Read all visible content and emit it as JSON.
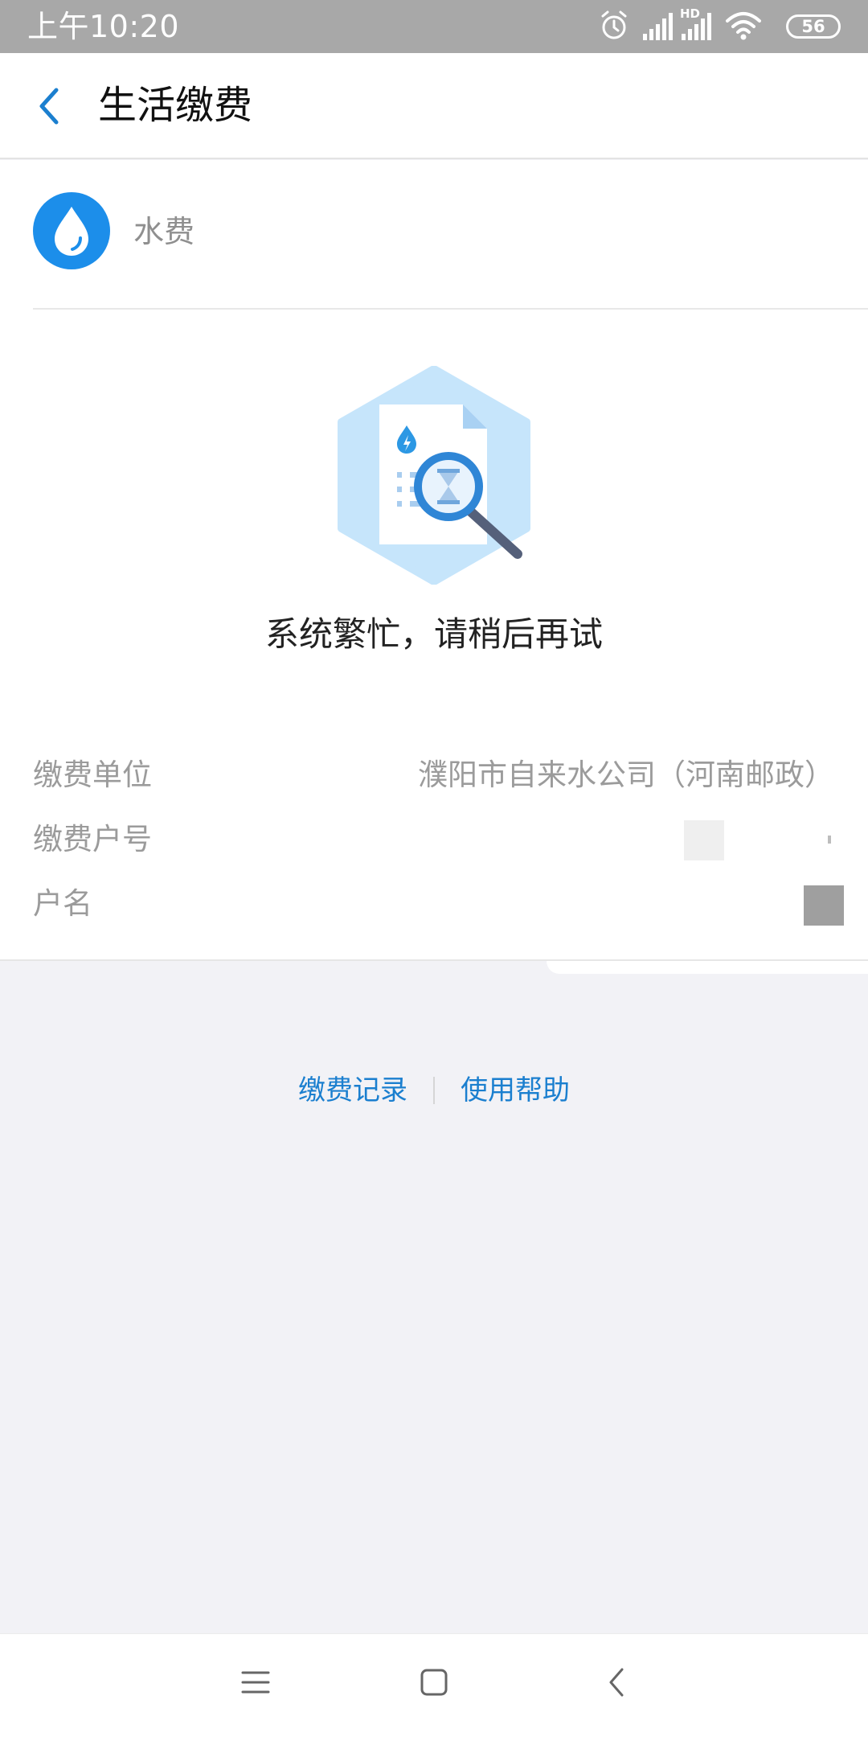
{
  "status_bar": {
    "time": "上午10:20",
    "network_badge": "HD",
    "battery_percent": "56",
    "icons": [
      "alarm-icon",
      "signal-icon",
      "hd-signal-icon",
      "wifi-icon",
      "battery-icon"
    ]
  },
  "header": {
    "back_icon": "chevron-left-icon",
    "title": "生活缴费"
  },
  "service": {
    "icon": "water-drop-icon",
    "name": "水费"
  },
  "result": {
    "illustration": "document-search-hourglass-icon",
    "message": "系统繁忙，请稍后再试"
  },
  "details": {
    "unit_label": "缴费单位",
    "unit_value": "濮阳市自来水公司（河南邮政）",
    "account_label": "缴费户号",
    "name_label": "户名"
  },
  "links": {
    "records": "缴费记录",
    "help": "使用帮助"
  },
  "nav_bar": {
    "icons": [
      "menu-icon",
      "home-icon",
      "back-icon"
    ]
  },
  "colors": {
    "accent": "#1b7fcf",
    "water_icon": "#1c8eea",
    "status_bar": "#a8a8a8",
    "page_background": "#f2f2f6"
  }
}
